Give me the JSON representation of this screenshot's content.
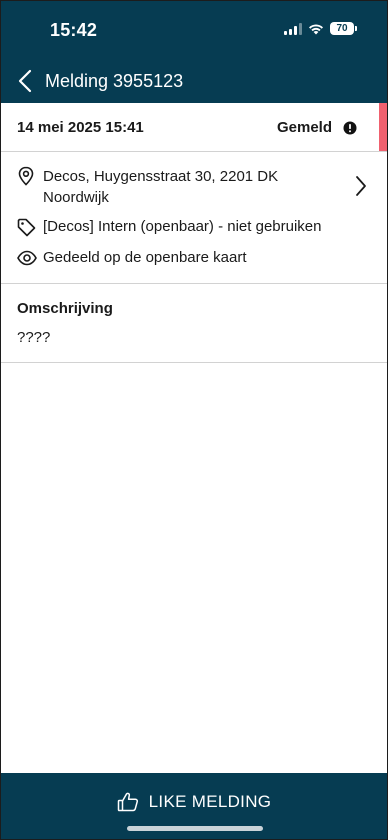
{
  "status_bar": {
    "time": "15:42",
    "battery": "70",
    "icons": [
      "signal-icon",
      "wifi-icon",
      "battery-icon"
    ]
  },
  "header": {
    "title": "Melding 3955123",
    "back_icon": "chevron-left-icon"
  },
  "report": {
    "date": "14 mei 2025 15:41",
    "status": "Gemeld",
    "status_icon": "alert-circle-icon",
    "status_color": "#f0616f"
  },
  "details": {
    "location": "Decos, Huygensstraat 30, 2201 DK Noordwijk",
    "category": "[Decos] Intern (openbaar) - niet gebruiken",
    "visibility": "Gedeeld op de openbare kaart",
    "icons": [
      "location-pin-icon",
      "tag-icon",
      "eye-icon",
      "chevron-right-icon"
    ]
  },
  "description": {
    "title": "Omschrijving",
    "text": "????"
  },
  "footer": {
    "like_label": "LIKE MELDING",
    "like_icon": "thumbs-up-icon"
  },
  "colors": {
    "primary": "#063c52",
    "accent": "#f0616f",
    "divider": "#d2d2d2"
  }
}
